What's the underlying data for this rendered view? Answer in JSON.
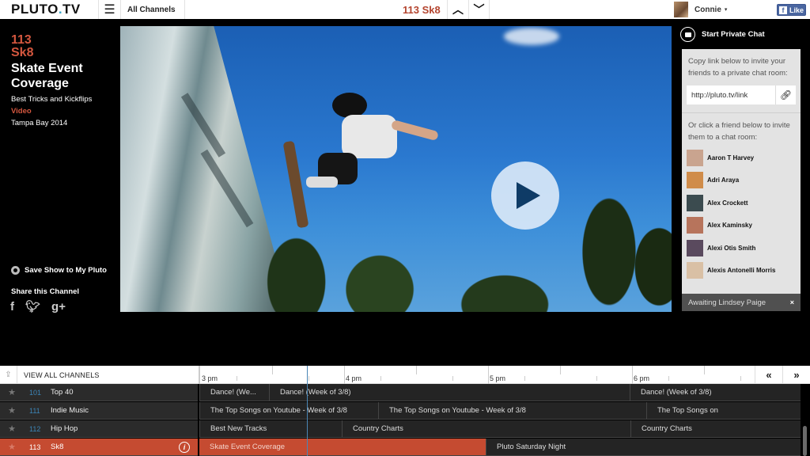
{
  "header": {
    "logo": {
      "part1": "PLUTO",
      "dot": ".",
      "part2": "TV"
    },
    "menu_icon": "hamburger-icon",
    "all_channels_label": "All Channels",
    "current_channel": "113 Sk8",
    "prev_channel_icon": "chevron-up-icon",
    "next_channel_icon": "chevron-down-icon",
    "user": {
      "name": "Connie",
      "caret": "▾"
    },
    "facebook_like": {
      "icon": "f",
      "label": "Like"
    }
  },
  "show_info": {
    "channel_number": "113",
    "channel_name": "Sk8",
    "title": "Skate Event Coverage",
    "description": "Best Tricks and Kickflips",
    "category": "Video",
    "meta": "Tampa Bay 2014",
    "save_label": "Save Show to My Pluto",
    "share_label": "Share this Channel",
    "share_icons": [
      "facebook-icon",
      "twitter-icon",
      "google-plus-icon"
    ]
  },
  "player": {
    "play_icon": "play-icon"
  },
  "chat": {
    "header": "Start Private Chat",
    "copy_instructions": "Copy link below to invite your friends to a private chat room:",
    "link_value": "http://pluto.tv/link",
    "friend_instructions": "Or click a friend below to invite them to a chat room:",
    "friends": [
      {
        "name": "Aaron T Harvey",
        "color": "#c9a48f"
      },
      {
        "name": "Adri Araya",
        "color": "#d08c4a"
      },
      {
        "name": "Alex Crockett",
        "color": "#3b4b4f"
      },
      {
        "name": "Alex Kaminsky",
        "color": "#b7745c"
      },
      {
        "name": "Alexi Otis Smith",
        "color": "#5a4a5e"
      },
      {
        "name": "Alexis Antonelli Morris",
        "color": "#d9c0a5"
      }
    ],
    "awaiting": "Awaiting Lindsey Paige",
    "close": "×"
  },
  "guide": {
    "view_all_label": "VIEW ALL CHANNELS",
    "times": [
      "3 pm",
      "4 pm",
      "5 pm",
      "6 pm"
    ],
    "prev_label": "«",
    "next_label": "»",
    "channels": [
      {
        "number": "101",
        "name": "Top 40",
        "programs": [
          {
            "title": "Dance! (We..."
          },
          {
            "title": "Dance! (Week of 3/8)"
          },
          {
            "title": "Dance! (Week of 3/8)"
          }
        ]
      },
      {
        "number": "111",
        "name": "Indie Music",
        "programs": [
          {
            "title": "The Top Songs on Youtube - Week of 3/8"
          },
          {
            "title": "The Top Songs on Youtube - Week of 3/8"
          },
          {
            "title": "The Top Songs on"
          }
        ]
      },
      {
        "number": "112",
        "name": "Hip Hop",
        "programs": [
          {
            "title": "Best New Tracks"
          },
          {
            "title": "Country Charts"
          },
          {
            "title": "Country Charts"
          }
        ]
      },
      {
        "number": "113",
        "name": "Sk8",
        "active": true,
        "programs": [
          {
            "title": "Skate Event Coverage"
          },
          {
            "title": "Pluto Saturday Night"
          }
        ]
      }
    ]
  },
  "colors": {
    "accent": "#c54b31",
    "channel_number": "#3c86b8",
    "now_line": "#4a86b5"
  }
}
